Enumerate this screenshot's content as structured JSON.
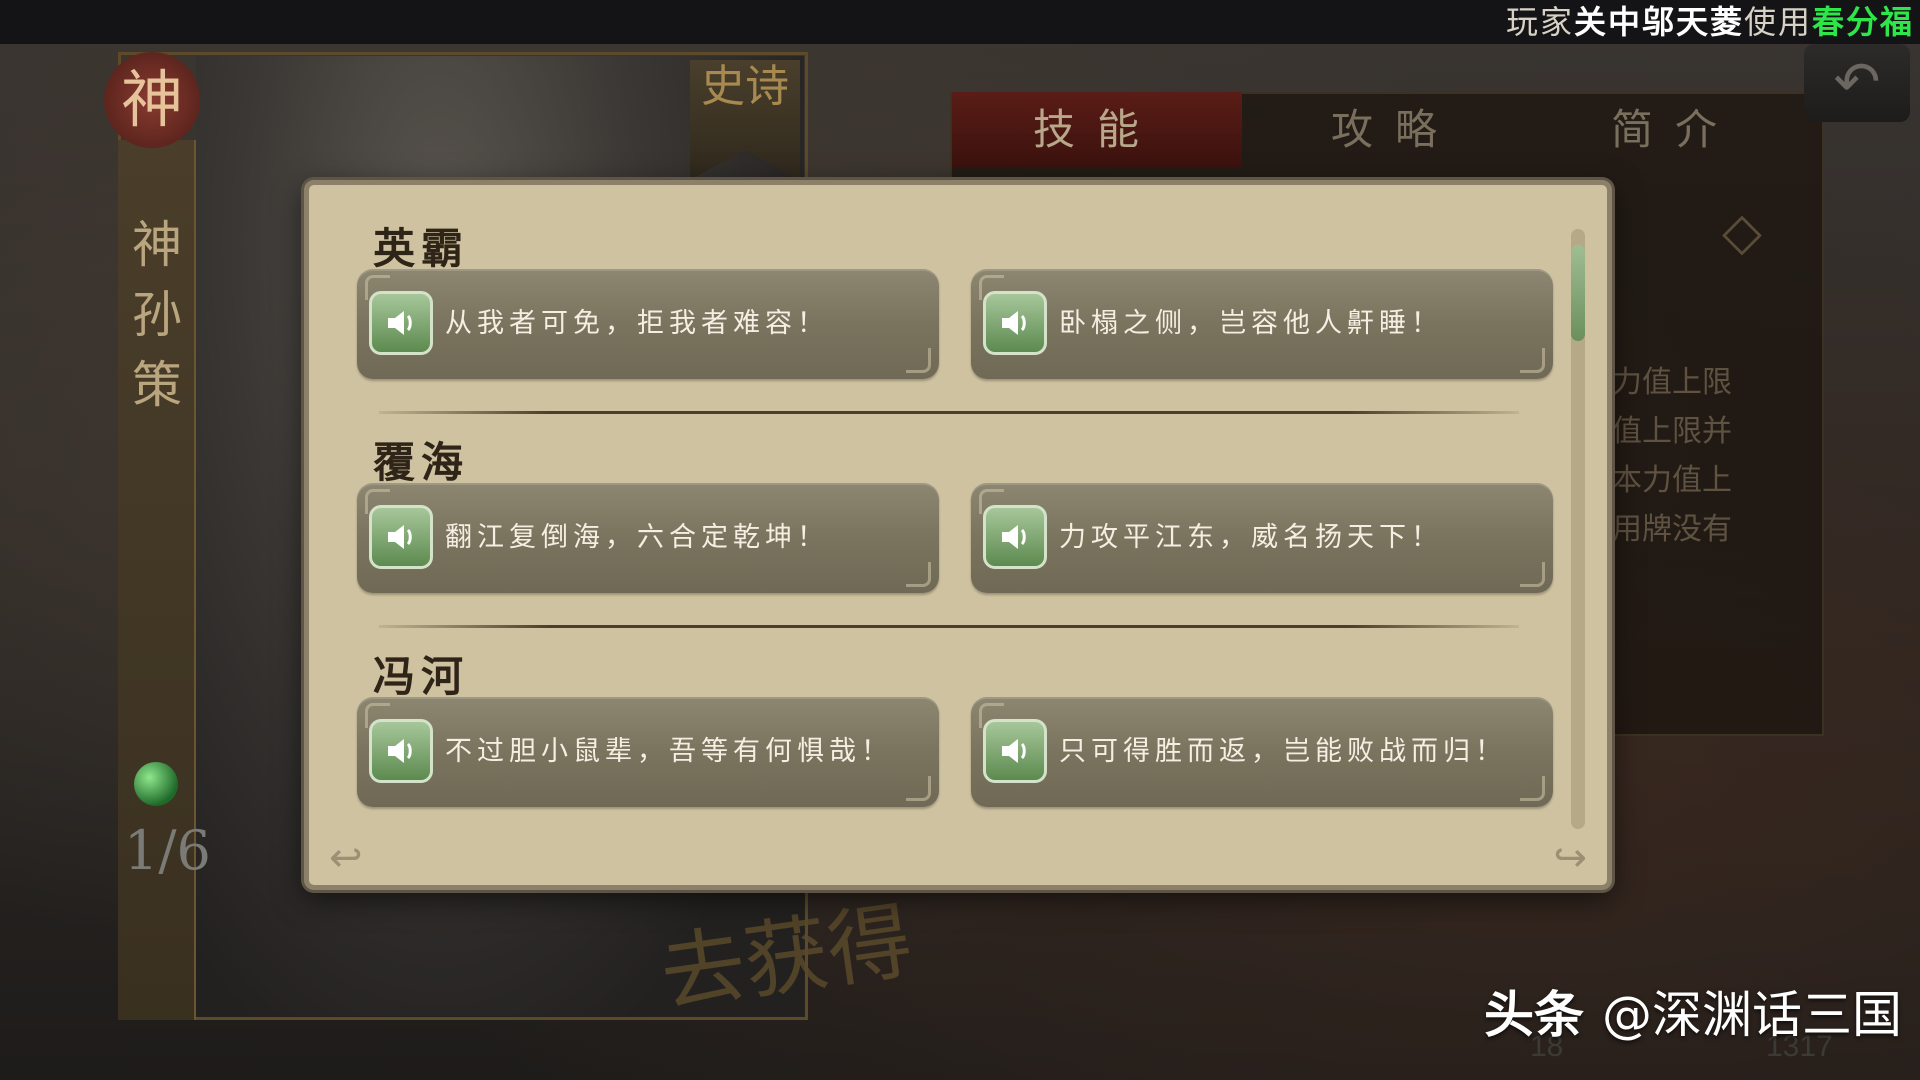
{
  "top_notice": {
    "prefix": "玩家",
    "player": "关中邬天菱",
    "middle": "使用",
    "card": "春分福"
  },
  "card": {
    "god_mark": "神",
    "name": "神孙策",
    "epic_label": "史诗",
    "page": "1/6"
  },
  "obtain_mark": "去获得",
  "tabs": {
    "skill": "技能",
    "guide": "攻略",
    "intro": "简介"
  },
  "info_bg_lines": [
    "力值上限",
    "值上限并",
    "本力值上",
    "用牌没有"
  ],
  "modal": {
    "sections": [
      {
        "title": "英霸",
        "quotes": [
          "从我者可免，拒我者难容！",
          "卧榻之侧，岂容他人鼾睡！"
        ]
      },
      {
        "title": "覆海",
        "quotes": [
          "翻江复倒海，六合定乾坤！",
          "力攻平江东，威名扬天下！"
        ]
      },
      {
        "title": "冯河",
        "quotes": [
          "不过胆小鼠辈，吾等有何惧哉！",
          "只可得胜而返，岂能败战而归！"
        ]
      }
    ]
  },
  "bottom_counters": [
    "18",
    "1317"
  ],
  "watermark": {
    "brand": "头条",
    "handle": "@深渊话三国"
  },
  "colors": {
    "modal_bg": "#cfc2a0",
    "quote_button": "#7a745f",
    "speaker_green": "#5c8a4f",
    "player_name": "#ffffff",
    "card_name_highlight": "#2ee64a"
  }
}
